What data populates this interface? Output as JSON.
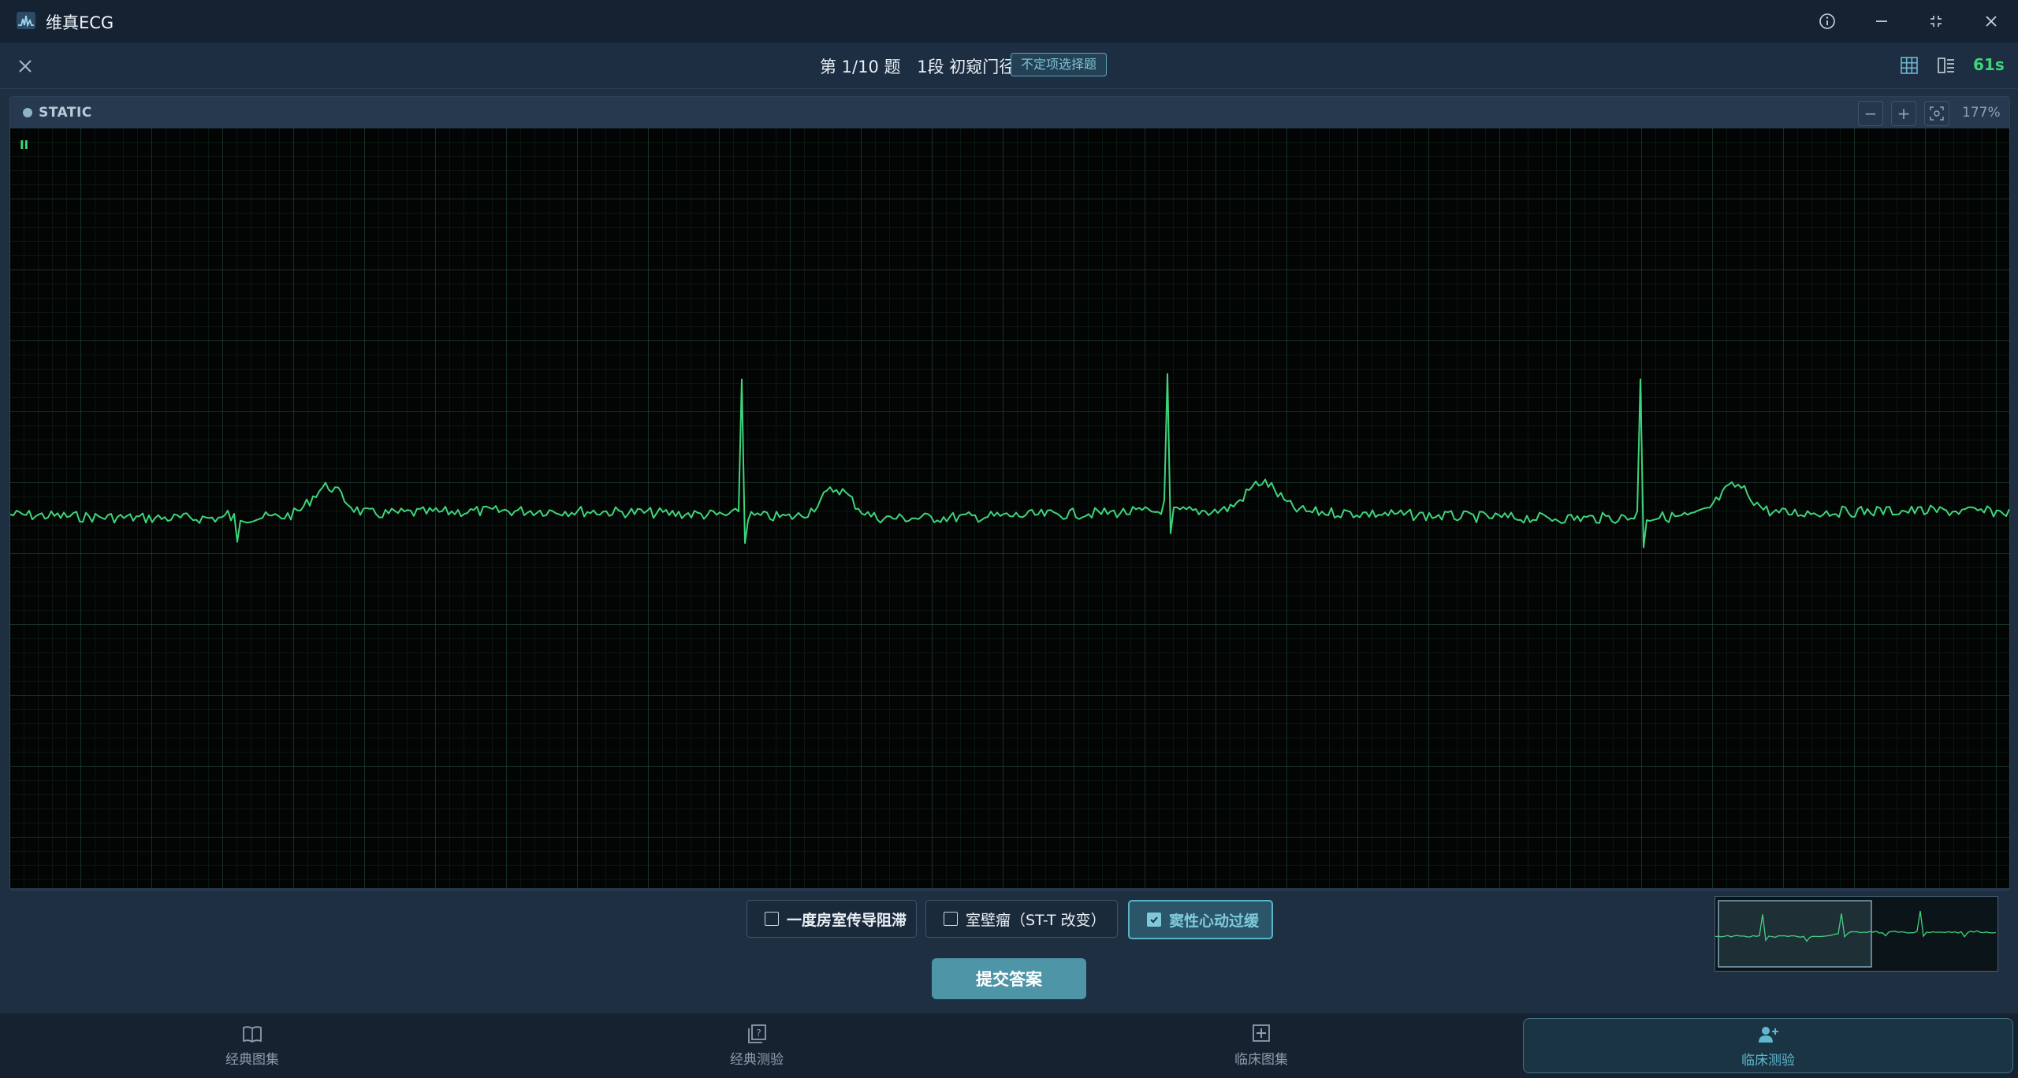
{
  "app": {
    "title": "维真ECG"
  },
  "header": {
    "question_no": "第 1/10 题",
    "section": "1段 初窥门径",
    "badge": "不定项选择题",
    "timer": "61s"
  },
  "panel": {
    "mode_label": "STATIC",
    "zoom": "177%",
    "zoom_out": "−",
    "zoom_in": "+"
  },
  "options": [
    {
      "label": "一度房室传导阻滞",
      "checked": false
    },
    {
      "label": "室壁瘤（ST-T 改变）",
      "checked": false
    },
    {
      "label": "窦性心动过缓",
      "checked": true
    }
  ],
  "submit_label": "提交答案",
  "nav": [
    {
      "label": "经典图集",
      "icon": "book-icon",
      "active": false
    },
    {
      "label": "经典测验",
      "icon": "quiz-icon",
      "active": false
    },
    {
      "label": "临床图集",
      "icon": "plus-square-icon",
      "active": false
    },
    {
      "label": "临床测验",
      "icon": "add-user-icon",
      "active": true
    }
  ],
  "colors": {
    "trace": "#3ed57a",
    "accent": "#58b4c7",
    "timer": "#3ed57a"
  }
}
